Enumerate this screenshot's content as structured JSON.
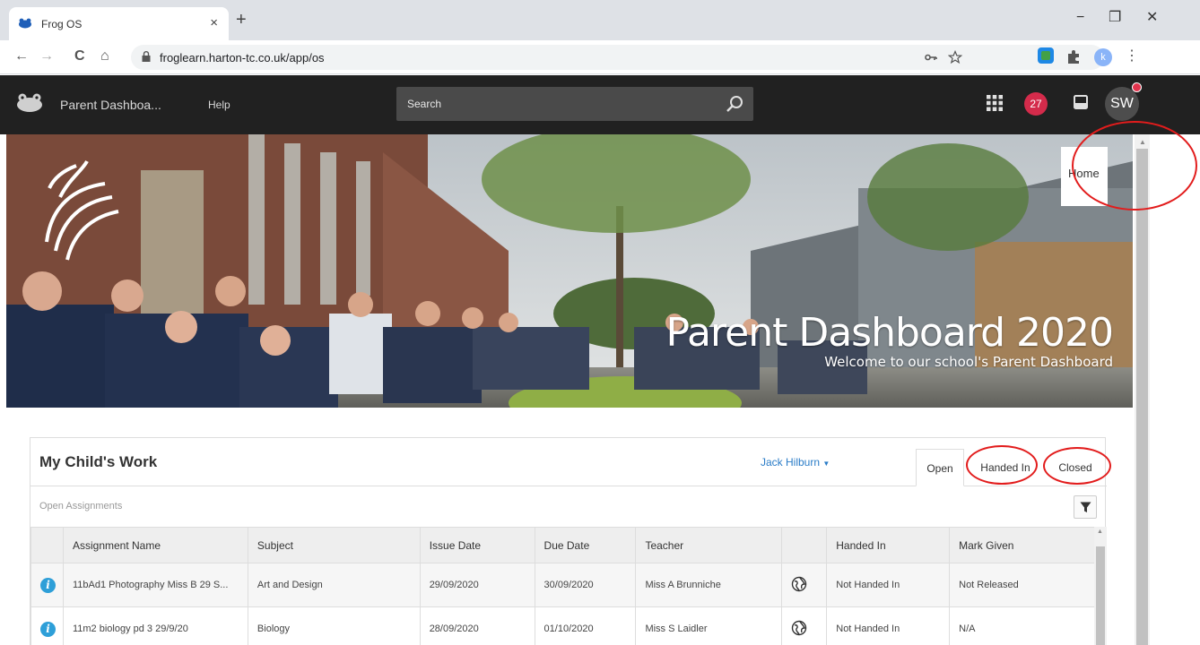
{
  "browser": {
    "tab_title": "Frog OS",
    "tab_close": "×",
    "new_tab": "+",
    "url": "froglearn.harton-tc.co.uk/app/os",
    "profile_initial": "k",
    "window_controls": {
      "minimize": "−",
      "restore": "❐",
      "close": "✕"
    },
    "nav": {
      "back": "←",
      "forward": "→",
      "reload": "C",
      "home": "⌂"
    },
    "icons": [
      "frog-favicon-icon",
      "lock-icon",
      "key-icon",
      "star-icon",
      "extension-icon",
      "puzzle-icon"
    ]
  },
  "app": {
    "title": "Parent Dashboa...",
    "help": "Help",
    "search_placeholder": "Search",
    "notification_count": "27",
    "user_initials": "SW",
    "accent_color": "#d42b4b"
  },
  "banner": {
    "title": "Parent Dashboard 2020",
    "subtitle": "Welcome to our school's Parent Dashboard",
    "home_button": "Home"
  },
  "widget": {
    "title": "My Child's Work",
    "child_name": "Jack Hilburn",
    "tabs": [
      "Open",
      "Handed In",
      "Closed"
    ],
    "active_tab": "Open",
    "sub_label": "Open Assignments",
    "columns": [
      "",
      "Assignment Name",
      "Subject",
      "Issue Date",
      "Due Date",
      "Teacher",
      "",
      "Handed In",
      "Mark Given"
    ],
    "rows": [
      {
        "name": "11bAd1 Photography Miss B 29 S...",
        "subject": "Art and Design",
        "issue": "29/09/2020",
        "due": "30/09/2020",
        "teacher": "Miss A Brunniche",
        "handed_in": "Not Handed In",
        "mark": "Not Released"
      },
      {
        "name": "11m2 biology pd 3 29/9/20",
        "subject": "Biology",
        "issue": "28/09/2020",
        "due": "01/10/2020",
        "teacher": "Miss S Laidler",
        "handed_in": "Not Handed In",
        "mark": "N/A"
      }
    ]
  },
  "annotation_color": "#e21c1c"
}
